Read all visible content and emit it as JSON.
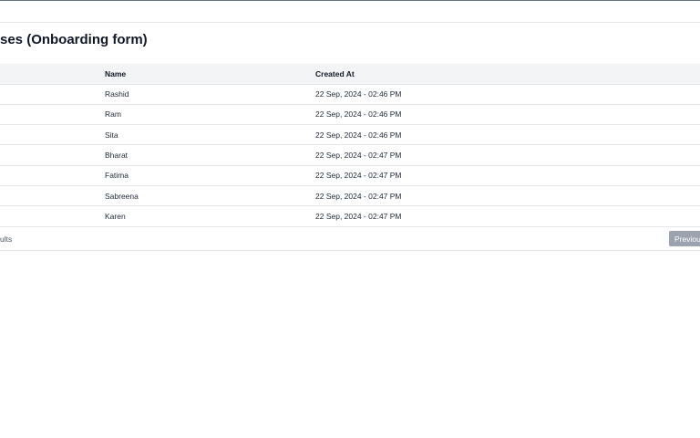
{
  "page": {
    "title": "ses (Onboarding form)"
  },
  "table": {
    "columns": [
      "",
      "Name",
      "Created At"
    ],
    "rows": [
      {
        "name": "Rashid",
        "created_at": "22 Sep, 2024 - 02:46 PM"
      },
      {
        "name": "Ram",
        "created_at": "22 Sep, 2024 - 02:46 PM"
      },
      {
        "name": "Sita",
        "created_at": "22 Sep, 2024 - 02:46 PM"
      },
      {
        "name": "Bharat",
        "created_at": "22 Sep, 2024 - 02:47 PM"
      },
      {
        "name": "Fatima",
        "created_at": "22 Sep, 2024 - 02:47 PM"
      },
      {
        "name": "Sabreena",
        "created_at": "22 Sep, 2024 - 02:47 PM"
      },
      {
        "name": "Karen",
        "created_at": "22 Sep, 2024 - 02:47 PM"
      }
    ]
  },
  "footer": {
    "results_text": "ults",
    "previous_label": "Previous"
  }
}
